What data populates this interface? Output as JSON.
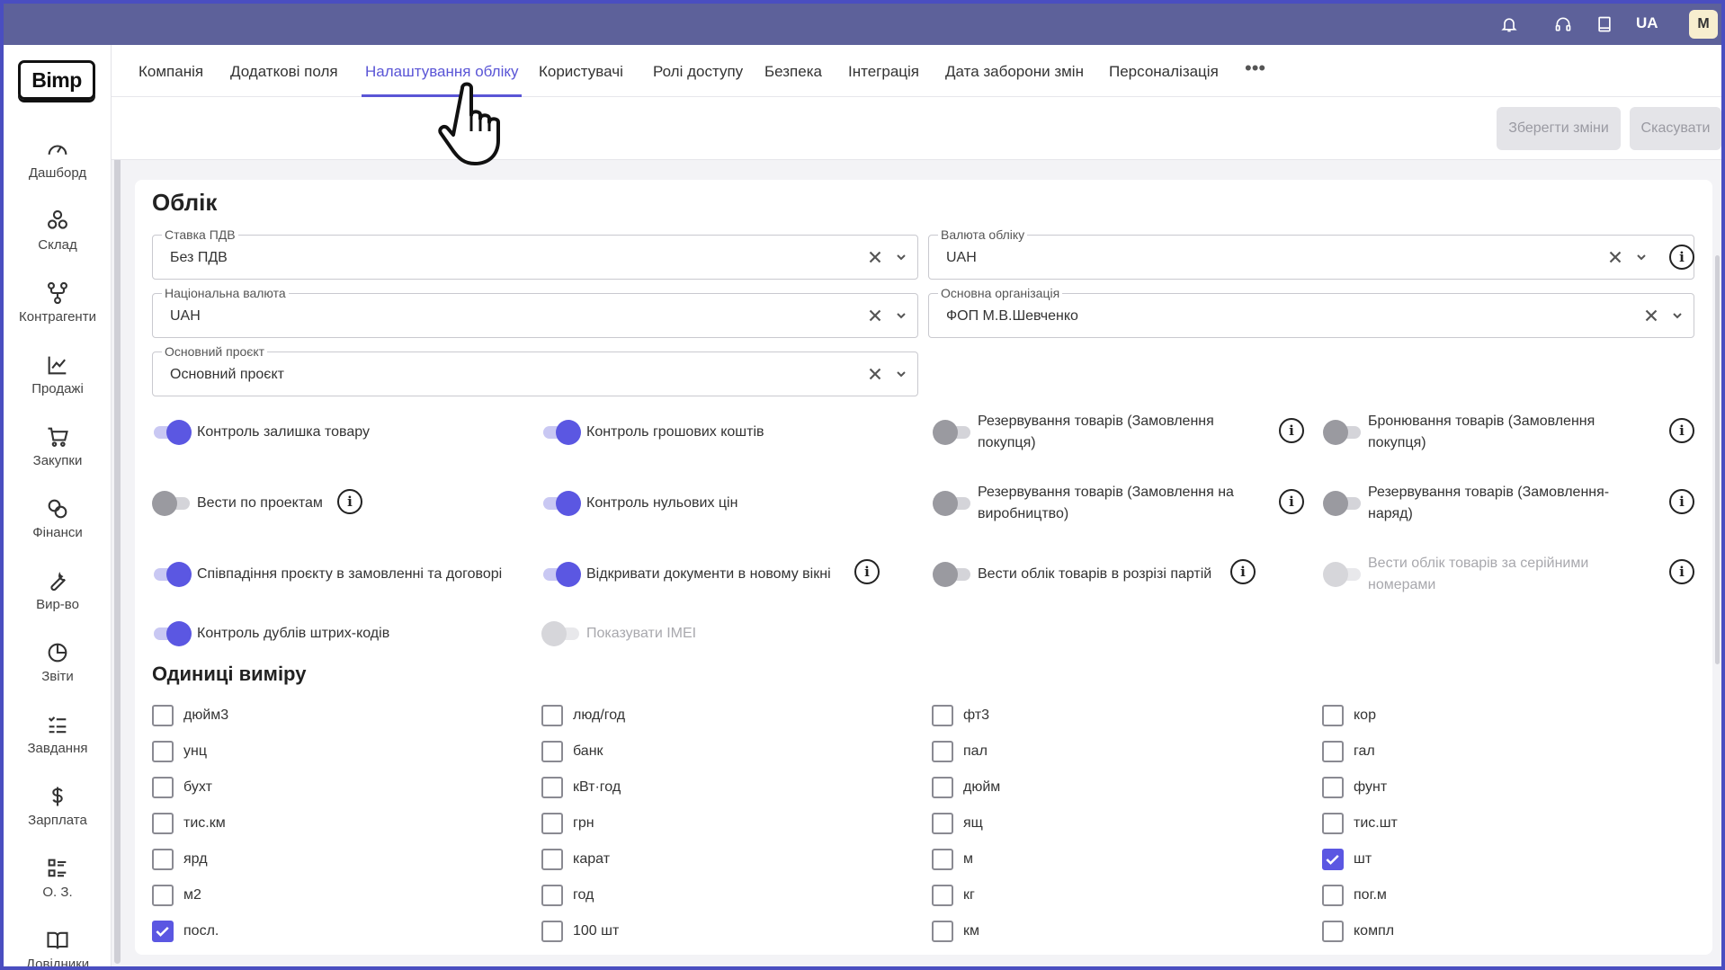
{
  "topbar": {
    "lang": "UA",
    "avatar": "M"
  },
  "sidebar": {
    "logo": "Bimp",
    "items": [
      {
        "label": "Дашборд",
        "icon": "gauge-icon"
      },
      {
        "label": "Склад",
        "icon": "boxes-icon"
      },
      {
        "label": "Контрагенти",
        "icon": "network-icon"
      },
      {
        "label": "Продажі",
        "icon": "chart-line-icon"
      },
      {
        "label": "Закупки",
        "icon": "cart-icon"
      },
      {
        "label": "Фінанси",
        "icon": "coins-icon"
      },
      {
        "label": "Вир-во",
        "icon": "wrench-icon"
      },
      {
        "label": "Звіти",
        "icon": "pie-chart-icon"
      },
      {
        "label": "Завдання",
        "icon": "task-list-icon"
      },
      {
        "label": "Зарплата",
        "icon": "dollar-icon"
      },
      {
        "label": "О. З.",
        "icon": "list-grid-icon"
      },
      {
        "label": "Довідники",
        "icon": "book-icon"
      }
    ]
  },
  "tabs": [
    {
      "label": "Компанія"
    },
    {
      "label": "Додаткові поля"
    },
    {
      "label": "Налаштування обліку",
      "active": true
    },
    {
      "label": "Користувачі"
    },
    {
      "label": "Ролі доступу"
    },
    {
      "label": "Безпека"
    },
    {
      "label": "Інтеграція"
    },
    {
      "label": "Дата заборони змін"
    },
    {
      "label": "Персоналізація"
    }
  ],
  "toolbar": {
    "save_label": "Зберегти зміни",
    "cancel_label": "Скасувати"
  },
  "accounting": {
    "title": "Облік",
    "fields": {
      "vat_rate": {
        "label": "Ставка ПДВ",
        "value": "Без ПДВ"
      },
      "accounting_currency": {
        "label": "Валюта обліку",
        "value": "UAH"
      },
      "national_currency": {
        "label": "Національна валюта",
        "value": "UAH"
      },
      "main_organization": {
        "label": "Основна організація",
        "value": "ФОП М.В.Шевченко"
      },
      "main_project": {
        "label": "Основний проєкт",
        "value": "Основний проєкт"
      }
    },
    "toggles": [
      {
        "label": "Контроль залишка товару",
        "state": "on"
      },
      {
        "label": "Контроль грошових коштів",
        "state": "on"
      },
      {
        "label": "Резервування товарів (Замовлення покупця)",
        "state": "off"
      },
      {
        "label": "Бронювання товарів (Замовлення покупця)",
        "state": "off"
      },
      {
        "label": "Вести по проектам",
        "state": "off"
      },
      {
        "label": "Контроль нульових цін",
        "state": "on"
      },
      {
        "label": "Резервування товарів (Замовлення на виробництво)",
        "state": "off"
      },
      {
        "label": "Резервування товарів (Замовлення-наряд)",
        "state": "off"
      },
      {
        "label": "Співпадіння проєкту в замовленні та договорі",
        "state": "on"
      },
      {
        "label": "Відкривати документи в новому вікні",
        "state": "on"
      },
      {
        "label": "Вести облік товарів в розрізі партій",
        "state": "off"
      },
      {
        "label": "Вести облік товарів за серійними номерами",
        "state": "disabled"
      },
      {
        "label": "Контроль дублів штрих-кодів",
        "state": "on"
      },
      {
        "label": "Показувати IMEI",
        "state": "disabled"
      }
    ]
  },
  "units": {
    "title": "Одиниці виміру",
    "columns": [
      [
        {
          "label": "дюйм3",
          "checked": false
        },
        {
          "label": "унц",
          "checked": false
        },
        {
          "label": "бухт",
          "checked": false
        },
        {
          "label": "тис.км",
          "checked": false
        },
        {
          "label": "ярд",
          "checked": false
        },
        {
          "label": "м2",
          "checked": false
        },
        {
          "label": "посл.",
          "checked": true
        }
      ],
      [
        {
          "label": "люд/год",
          "checked": false
        },
        {
          "label": "банк",
          "checked": false
        },
        {
          "label": "кВт·год",
          "checked": false
        },
        {
          "label": "грн",
          "checked": false
        },
        {
          "label": "карат",
          "checked": false
        },
        {
          "label": "год",
          "checked": false
        },
        {
          "label": "100 шт",
          "checked": false
        }
      ],
      [
        {
          "label": "фт3",
          "checked": false
        },
        {
          "label": "пал",
          "checked": false
        },
        {
          "label": "дюйм",
          "checked": false
        },
        {
          "label": "ящ",
          "checked": false
        },
        {
          "label": "м",
          "checked": false
        },
        {
          "label": "кг",
          "checked": false
        },
        {
          "label": "км",
          "checked": false
        }
      ],
      [
        {
          "label": "кор",
          "checked": false
        },
        {
          "label": "гал",
          "checked": false
        },
        {
          "label": "фунт",
          "checked": false
        },
        {
          "label": "тис.шт",
          "checked": false
        },
        {
          "label": "шт",
          "checked": true
        },
        {
          "label": "пог.м",
          "checked": false
        },
        {
          "label": "компл",
          "checked": false
        }
      ]
    ]
  }
}
